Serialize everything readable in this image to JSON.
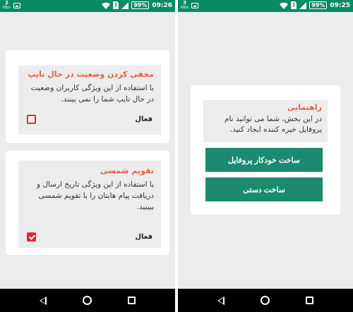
{
  "left_screen": {
    "status_bar": {
      "speed": "2",
      "speed_unit": "KB/s",
      "sim": "1",
      "battery": "99%",
      "time": "09:26"
    },
    "typing_card": {
      "title": "مخفی کردن وضعیت در حال تایپ",
      "description": "با استفاده از این ویژگی کاربران وضعیت در حال تایپ شما را نمی بینند.",
      "toggle_label": "فعال",
      "checked": false
    },
    "calendar_card": {
      "title": "تقویم شمسی",
      "description": "با استفاده از این ویژگی تاریخ ارسال و دریافت پیام هایتان را با تقویم شمسی ببینید.",
      "toggle_label": "فعال",
      "checked": true
    }
  },
  "right_screen": {
    "status_bar": {
      "speed": "3",
      "speed_unit": "KB/s",
      "sim": "1",
      "battery": "99%",
      "time": "09:25"
    },
    "guide": {
      "title": "راهنمایی",
      "description": "در این بخش، شما می توانید نام پروفایل خیره کننده ایجاد کنید."
    },
    "buttons": {
      "auto_build": "ساخت خودکار پروفایل",
      "manual_build": "ساخت دستی"
    }
  },
  "colors": {
    "status_bar": "#0a8a64",
    "accent_title": "#e3603a",
    "button": "#1b8a6e",
    "checkbox": "#d7283a"
  }
}
